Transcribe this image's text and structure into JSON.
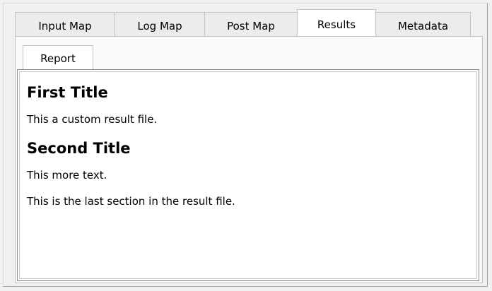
{
  "tabs": [
    {
      "label": "Input Map",
      "active": false
    },
    {
      "label": "Log Map",
      "active": false
    },
    {
      "label": "Post Map",
      "active": false
    },
    {
      "label": "Results",
      "active": true
    },
    {
      "label": "Metadata",
      "active": false
    }
  ],
  "subtabs": [
    {
      "label": "Report",
      "active": true
    }
  ],
  "report": {
    "heading1": "First Title",
    "para1": "This a custom result file.",
    "heading2": "Second Title",
    "para2": "This more text.",
    "para3": "This is the last section in the result file."
  }
}
